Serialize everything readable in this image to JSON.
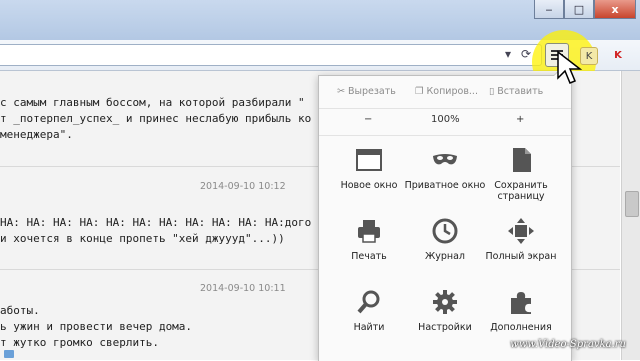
{
  "window": {
    "minimize": "‒",
    "maximize": "□",
    "close": "x"
  },
  "content": {
    "entry1": {
      "lines": [
        "с самым главным боссом, на которой разбирали \"",
        "т _потерпел_успех_ и принес неслабую прибыль ко",
        "менеджера\"."
      ]
    },
    "entry2": {
      "timestamp": "2014-09-10 10:12",
      "lines": [
        "HA: HA: HA: HA: HA: HA: HA: HA: HA: HA: HA:дого",
        "и хочется в конце пропеть \"хей джуууд\"...))"
      ]
    },
    "entry3": {
      "timestamp": "2014-09-10 10:11",
      "lines": [
        "аботы.",
        "ь ужин и провести вечер дома.",
        "т жутко громко сверлить."
      ]
    }
  },
  "menu": {
    "cut": "Вырезать",
    "copy": "Копиров...",
    "paste": "Вставить",
    "zoom_out": "−",
    "zoom_level": "100%",
    "zoom_in": "+",
    "items": [
      {
        "label": "Новое окно",
        "icon": "new-window-icon"
      },
      {
        "label": "Приватное окно",
        "icon": "private-mask-icon"
      },
      {
        "label": "Сохранить страницу",
        "icon": "save-page-icon"
      },
      {
        "label": "Печать",
        "icon": "printer-icon"
      },
      {
        "label": "Журнал",
        "icon": "history-clock-icon"
      },
      {
        "label": "Полный экран",
        "icon": "fullscreen-icon"
      },
      {
        "label": "Найти",
        "icon": "search-icon"
      },
      {
        "label": "Настройки",
        "icon": "gear-icon"
      },
      {
        "label": "Дополнения",
        "icon": "puzzle-icon"
      }
    ]
  },
  "watermark": "www.Video-Spravka.ru",
  "colors": {
    "highlight": "#fff200",
    "panel": "#fafafa",
    "page": "#f3f3f3"
  }
}
